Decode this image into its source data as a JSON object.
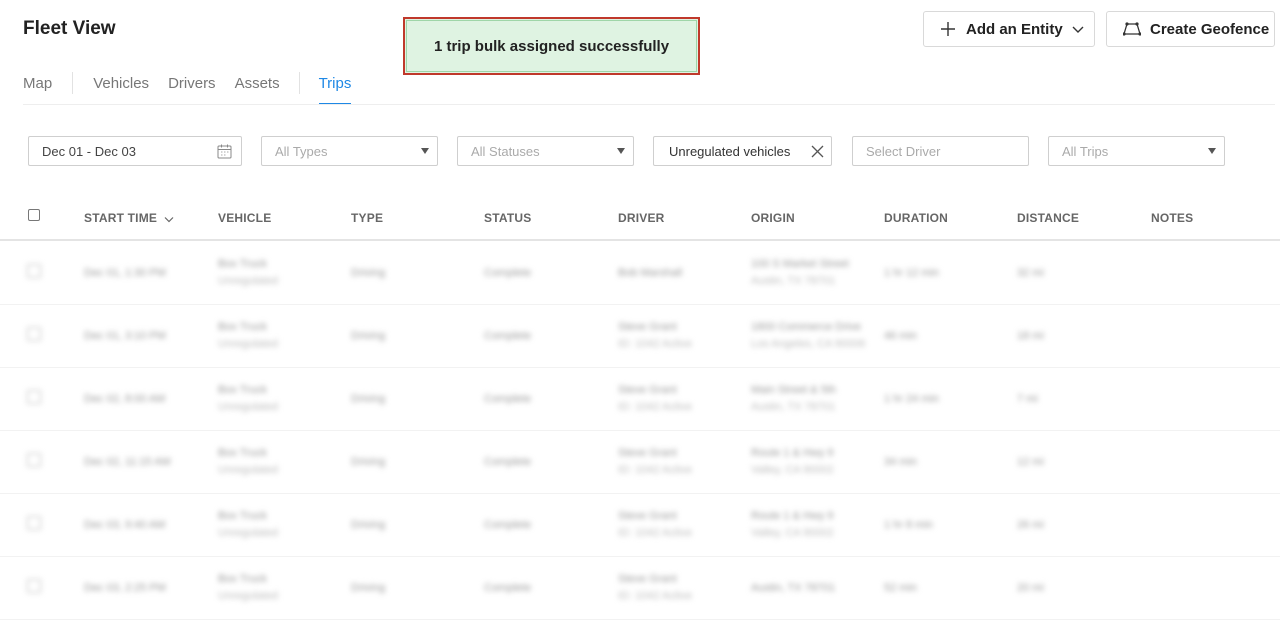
{
  "header": {
    "title": "Fleet View",
    "tabs": [
      {
        "label": "Map"
      },
      {
        "label": "Vehicles"
      },
      {
        "label": "Drivers"
      },
      {
        "label": "Assets"
      },
      {
        "label": "Trips",
        "active": true
      }
    ],
    "add_entity_label": "Add an Entity",
    "create_geofence_label": "Create Geofence"
  },
  "toast": {
    "message": "1 trip bulk assigned successfully"
  },
  "filters": {
    "date_range": "Dec 01 - Dec 03",
    "types": "All Types",
    "statuses": "All Statuses",
    "vehicle_filter": "Unregulated vehicles",
    "driver_placeholder": "Select Driver",
    "trips": "All Trips"
  },
  "table": {
    "columns": [
      "START TIME",
      "VEHICLE",
      "TYPE",
      "STATUS",
      "DRIVER",
      "ORIGIN",
      "DURATION",
      "DISTANCE",
      "NOTES"
    ],
    "rows": [
      {
        "start": "Dec 01, 1:30 PM",
        "vehicle": "Box Truck",
        "vehicle_sub": "Unregulated",
        "type": "Driving",
        "status": "Complete",
        "driver": "Bob Marshall",
        "driver_sub": "",
        "origin": "100 S Market Street",
        "origin_sub": "Austin, TX 78701",
        "duration": "1 hr 12 min",
        "distance": "32 mi"
      },
      {
        "start": "Dec 01, 3:10 PM",
        "vehicle": "Box Truck",
        "vehicle_sub": "Unregulated",
        "type": "Driving",
        "status": "Complete",
        "driver": "Steve Grant",
        "driver_sub": "ID: 1042 Active",
        "origin": "1800 Commerce Drive",
        "origin_sub": "Los Angeles, CA 90006",
        "duration": "46 min",
        "distance": "18 mi"
      },
      {
        "start": "Dec 02, 8:00 AM",
        "vehicle": "Box Truck",
        "vehicle_sub": "Unregulated",
        "type": "Driving",
        "status": "Complete",
        "driver": "Steve Grant",
        "driver_sub": "ID: 1042 Active",
        "origin": "Main Street & 5th",
        "origin_sub": "Austin, TX 78701",
        "duration": "1 hr 24 min",
        "distance": "7 mi"
      },
      {
        "start": "Dec 02, 11:15 AM",
        "vehicle": "Box Truck",
        "vehicle_sub": "Unregulated",
        "type": "Driving",
        "status": "Complete",
        "driver": "Steve Grant",
        "driver_sub": "ID: 1042 Active",
        "origin": "Route 1 & Hwy 9",
        "origin_sub": "Valley, CA 90002",
        "duration": "34 min",
        "distance": "12 mi"
      },
      {
        "start": "Dec 03, 9:40 AM",
        "vehicle": "Box Truck",
        "vehicle_sub": "Unregulated",
        "type": "Driving",
        "status": "Complete",
        "driver": "Steve Grant",
        "driver_sub": "ID: 1042 Active",
        "origin": "Route 1 & Hwy 9",
        "origin_sub": "Valley, CA 90002",
        "duration": "1 hr 8 min",
        "distance": "26 mi"
      },
      {
        "start": "Dec 03, 2:25 PM",
        "vehicle": "Box Truck",
        "vehicle_sub": "Unregulated",
        "type": "Driving",
        "status": "Complete",
        "driver": "Steve Grant",
        "driver_sub": "ID: 1042 Active",
        "origin": "Austin, TX 78701",
        "origin_sub": "",
        "duration": "52 min",
        "distance": "20 mi"
      }
    ]
  },
  "colors": {
    "accent": "#1e88e5",
    "toast_bg": "#dff3e2",
    "toast_border": "#c0392b"
  },
  "icons": [
    "plus-icon",
    "chevron-down-icon",
    "geofence-icon",
    "calendar-icon",
    "caret-down-icon",
    "close-icon"
  ]
}
